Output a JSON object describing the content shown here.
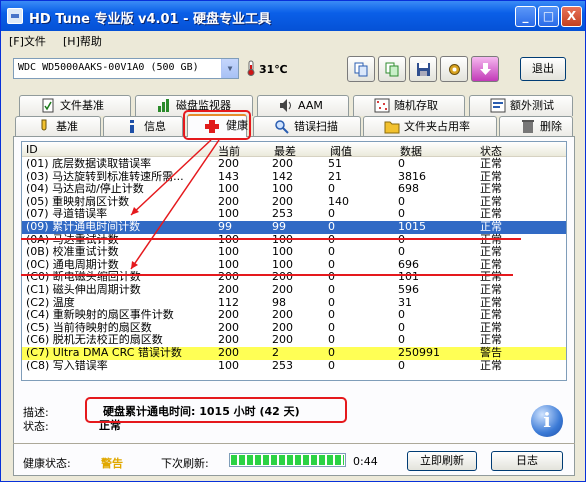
{
  "window": {
    "title": "HD Tune 专业版 v4.01 - 硬盘专业工具",
    "controls": {
      "minimize": "_",
      "maximize": "□",
      "close": "X"
    }
  },
  "menu": [
    {
      "label": "[F]文件"
    },
    {
      "label": "[H]帮助"
    }
  ],
  "toolbar": {
    "device": "WDC WD5000AAKS-00V1A0 (500 GB)",
    "temperature": "31℃",
    "exit_label": "退出"
  },
  "tabs_top": [
    {
      "label": "文件基准",
      "icon": "file-benchmark-icon"
    },
    {
      "label": "磁盘监视器",
      "icon": "disk-monitor-icon"
    },
    {
      "label": "AAM",
      "icon": "speaker-icon"
    },
    {
      "label": "随机存取",
      "icon": "random-access-icon"
    },
    {
      "label": "额外测试",
      "icon": "extra-tests-icon"
    }
  ],
  "tabs_bottom": [
    {
      "label": "基准",
      "icon": "benchmark-icon"
    },
    {
      "label": "信息",
      "icon": "info-icon"
    },
    {
      "label": "健康",
      "icon": "health-cross-icon",
      "active": true
    },
    {
      "label": "错误扫描",
      "icon": "magnifier-icon"
    },
    {
      "label": "文件夹占用率",
      "icon": "folder-icon"
    },
    {
      "label": "删除",
      "icon": "trash-icon"
    }
  ],
  "table": {
    "headers": [
      "ID",
      "当前",
      "最差",
      "阈值",
      "数据",
      "状态"
    ],
    "rows": [
      {
        "id": "(01) 底层数据读取错误率",
        "cur": "200",
        "worst": "200",
        "thr": "51",
        "data": "0",
        "status": "正常"
      },
      {
        "id": "(03) 马达旋转到标准转速所需...",
        "cur": "143",
        "worst": "142",
        "thr": "21",
        "data": "3816",
        "status": "正常"
      },
      {
        "id": "(04) 马达启动/停止计数",
        "cur": "100",
        "worst": "100",
        "thr": "0",
        "data": "698",
        "status": "正常"
      },
      {
        "id": "(05) 重映射扇区计数",
        "cur": "200",
        "worst": "200",
        "thr": "140",
        "data": "0",
        "status": "正常"
      },
      {
        "id": "(07) 寻道错误率",
        "cur": "100",
        "worst": "253",
        "thr": "0",
        "data": "0",
        "status": "正常"
      },
      {
        "id": "(09) 累计通电时间计数",
        "cur": "99",
        "worst": "99",
        "thr": "0",
        "data": "1015",
        "status": "正常",
        "selected": true
      },
      {
        "id": "(0A) 马达重试计数",
        "cur": "100",
        "worst": "100",
        "thr": "0",
        "data": "0",
        "status": "正常"
      },
      {
        "id": "(0B) 校准重试计数",
        "cur": "100",
        "worst": "100",
        "thr": "0",
        "data": "0",
        "status": "正常"
      },
      {
        "id": "(0C) 通电周期计数",
        "cur": "100",
        "worst": "100",
        "thr": "0",
        "data": "696",
        "status": "正常"
      },
      {
        "id": "(C0) 断电磁头缩回计数",
        "cur": "200",
        "worst": "200",
        "thr": "0",
        "data": "101",
        "status": "正常"
      },
      {
        "id": "(C1) 磁头伸出周期计数",
        "cur": "200",
        "worst": "200",
        "thr": "0",
        "data": "596",
        "status": "正常"
      },
      {
        "id": "(C2) 温度",
        "cur": "112",
        "worst": "98",
        "thr": "0",
        "data": "31",
        "status": "正常"
      },
      {
        "id": "(C4) 重新映射的扇区事件计数",
        "cur": "200",
        "worst": "200",
        "thr": "0",
        "data": "0",
        "status": "正常"
      },
      {
        "id": "(C5) 当前待映射的扇区数",
        "cur": "200",
        "worst": "200",
        "thr": "0",
        "data": "0",
        "status": "正常"
      },
      {
        "id": "(C6) 脱机无法校正的扇区数",
        "cur": "200",
        "worst": "200",
        "thr": "0",
        "data": "0",
        "status": "正常"
      },
      {
        "id": "(C7) Ultra DMA CRC 错误计数",
        "cur": "200",
        "worst": "2",
        "thr": "0",
        "data": "250991",
        "status": "警告",
        "warn": true
      },
      {
        "id": "(C8) 写入错误率",
        "cur": "100",
        "worst": "253",
        "thr": "0",
        "data": "0",
        "status": "正常"
      }
    ]
  },
  "details": {
    "desc_label": "描述:",
    "desc_value": "硬盘累计通电时间: 1015 小时 (42 天)",
    "state_label": "状态:",
    "state_value": "正常"
  },
  "footer": {
    "health_label": "健康状态:",
    "health_value": "警告",
    "refresh_label": "下次刷新:",
    "refresh_progress": 1.0,
    "time": "0:44",
    "refresh_now": "立即刷新",
    "log": "日志"
  },
  "colors": {
    "selected": "#316ac5",
    "warn_row": "#ffff55",
    "annotation": "#e5191d",
    "health_warn": "#e0a800"
  }
}
